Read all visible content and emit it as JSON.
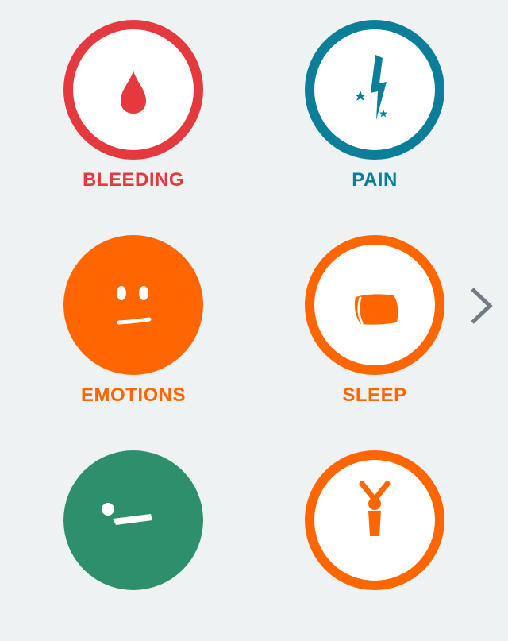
{
  "categories": [
    {
      "label": "BLEEDING",
      "color": "#e3393f",
      "style": "ring",
      "icon": "blood-drop-icon"
    },
    {
      "label": "PAIN",
      "color": "#0b7f9a",
      "style": "ring",
      "icon": "lightning-bolt-icon"
    },
    {
      "label": "EMOTIONS",
      "color": "#ff6600",
      "style": "filled",
      "icon": "face-icon"
    },
    {
      "label": "SLEEP",
      "color": "#ff6600",
      "style": "ring",
      "icon": "pillow-icon"
    },
    {
      "label": "",
      "color": "#2d8f6b",
      "style": "filled",
      "icon": "exercise-icon"
    },
    {
      "label": "",
      "color": "#ff6600",
      "style": "ring",
      "icon": "raised-arms-person-icon"
    }
  ],
  "navigation": {
    "next_icon": "chevron-right-icon",
    "next_color": "#6f7c85"
  }
}
